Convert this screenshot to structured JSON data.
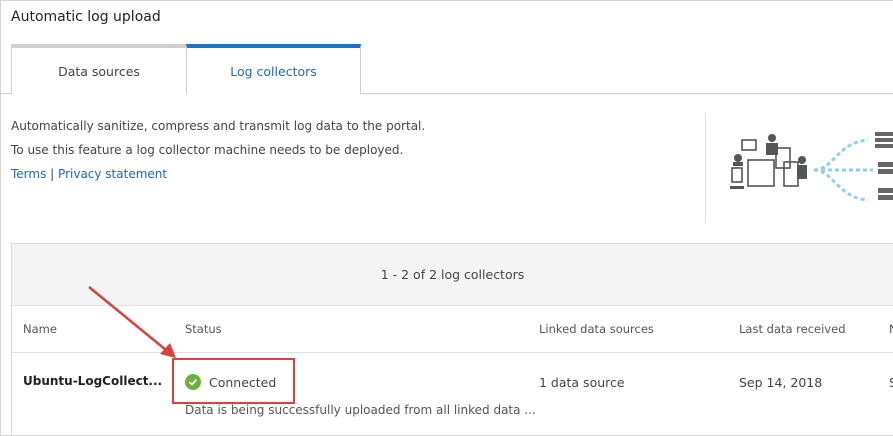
{
  "title": "Automatic log upload",
  "tabs": [
    {
      "label": "Data sources",
      "active": false
    },
    {
      "label": "Log collectors",
      "active": true
    }
  ],
  "description": {
    "line1": "Automatically sanitize, compress and transmit log data to the portal.",
    "line2": "To use this feature a log collector machine needs to be deployed."
  },
  "links": {
    "terms": "Terms",
    "separator": "|",
    "privacy": "Privacy statement"
  },
  "illustration": {
    "icon": "devices-to-servers-icon"
  },
  "table": {
    "summary": "1 - 2 of 2 log collectors",
    "columns": {
      "name": "Name",
      "status": "Status",
      "linked": "Linked data sources",
      "last": "Last data received",
      "extra": "N"
    },
    "rows": [
      {
        "name": "Ubuntu-LogCollect...",
        "status": "Connected",
        "status_detail": "Data is being successfully uploaded from all linked data ...",
        "linked": "1 data source",
        "last": "Sep 14, 2018",
        "extra": "S"
      }
    ]
  },
  "colors": {
    "accent": "#1a73c9",
    "success": "#6bb33c",
    "callout": "#d9423d"
  }
}
